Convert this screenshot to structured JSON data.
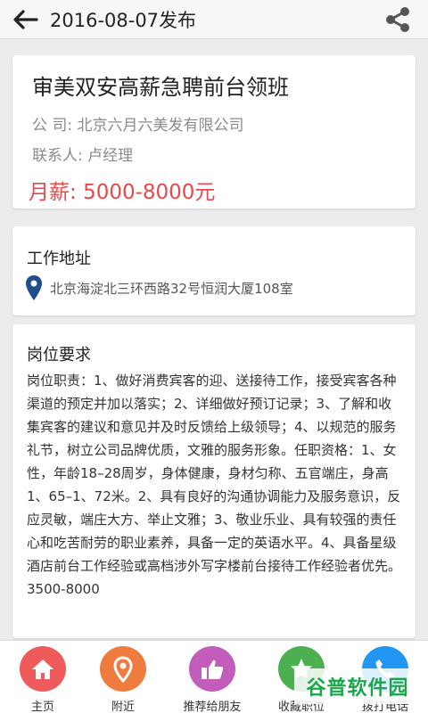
{
  "header": {
    "title": "2016-08-07发布"
  },
  "job": {
    "title": "审美双安高薪急聘前台领班",
    "company_label": "公 司:",
    "company": "北京六月六美发有限公司",
    "contact_label": "联系人:",
    "contact": "卢经理",
    "salary_label": "月薪:",
    "salary": "5000-8000元"
  },
  "address": {
    "section_title": "工作地址",
    "text": "北京海淀北三环西路32号恒润大厦108室"
  },
  "requirements": {
    "section_title": "岗位要求",
    "body": "岗位职责：1、做好消费宾客的迎、送接待工作，接受宾客各种渠道的预定并加以落实；2、详细做好预订记录；3、了解和收集宾客的建议和意见并及时反馈给上级领导；4、以规范的服务礼节，树立公司品牌优质，文雅的服务形象。任职资格：1、女性，年龄18–28周岁，身体健康，身材匀称、五官端庄，身高1、65–1、72米。2、具有良好的沟通协调能力及服务意识，反应灵敏，端庄大方、举止文雅；3、敬业乐业、具有较强的责任心和吃苦耐劳的职业素养，具备一定的英语水平。4、具备星级酒店前台工作经验或高档涉外写字楼前台接待工作经验者优先。3500-8000"
  },
  "nav": {
    "home": "主页",
    "nearby": "附近",
    "recommend": "推荐给朋友",
    "favorite": "收藏职位",
    "call": "拨打电话"
  },
  "watermark": {
    "text": "谷普软件园"
  },
  "colors": {
    "salary": "#e8484b",
    "home": "#ef5a5a",
    "nearby": "#f07b3f",
    "recommend": "#c25dbb",
    "favorite": "#4caf50",
    "call": "#2196f3"
  }
}
